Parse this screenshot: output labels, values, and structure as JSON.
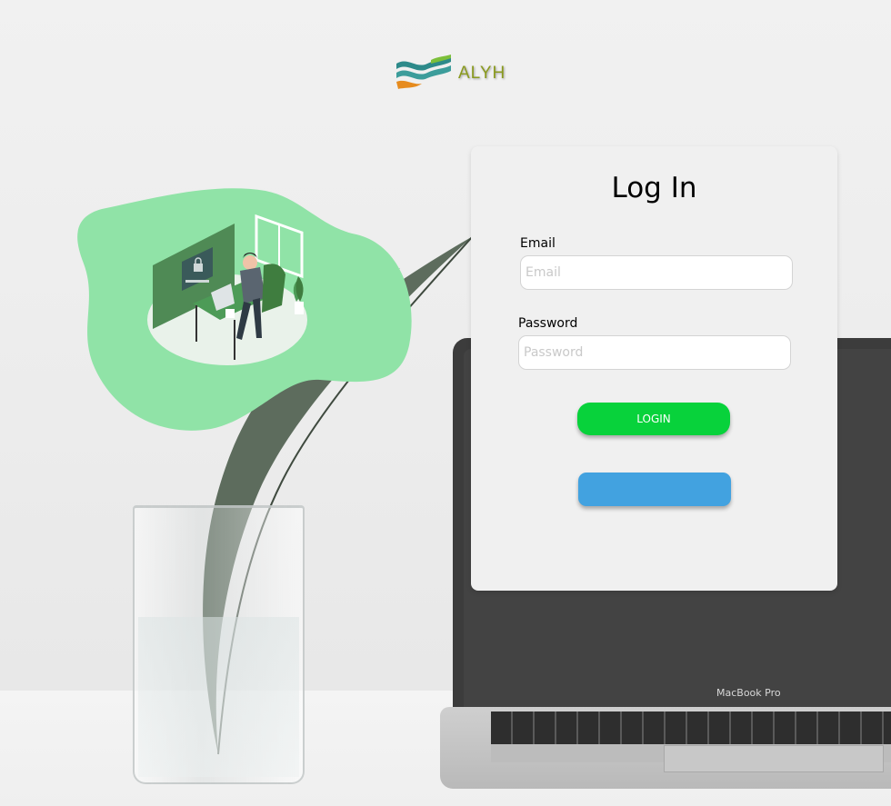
{
  "brand": {
    "name": "ALYH",
    "laptop_label": "MacBook Pro"
  },
  "login": {
    "title": "Log In",
    "email_label": "Email",
    "email_placeholder": "Email",
    "email_value": "",
    "password_label": "Password",
    "password_placeholder": "Password",
    "password_value": "",
    "login_button": "LOGIN",
    "secondary_button": ""
  },
  "colors": {
    "login_button": "#08d23b",
    "secondary_button": "#42a2e0",
    "blob": "#90e3a7",
    "logo_text": "#8a9a1f"
  },
  "icons": {
    "logo": "wave-logo-icon",
    "illustration": "person-working-laptop-illustration"
  }
}
